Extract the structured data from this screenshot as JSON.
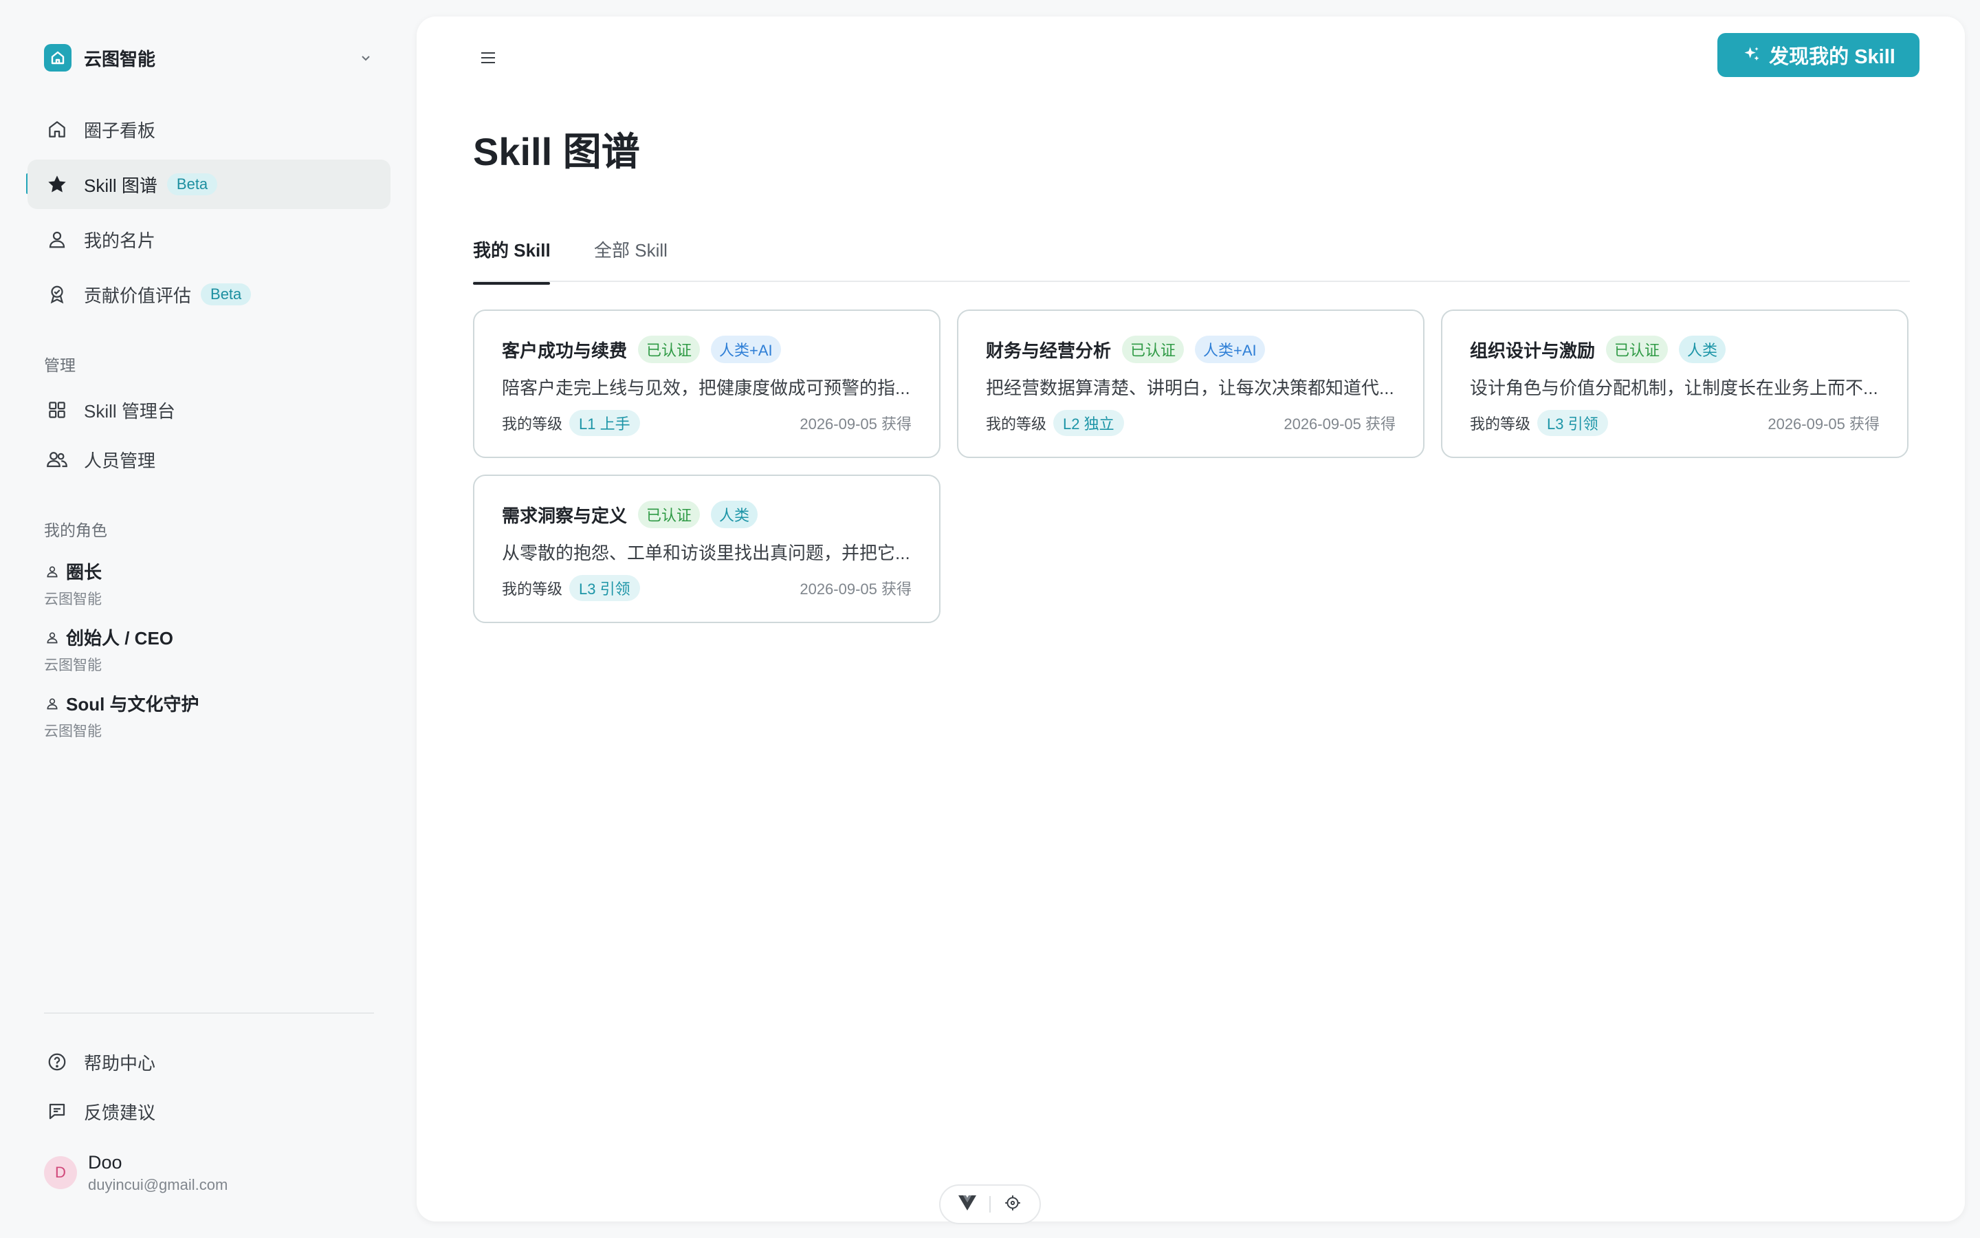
{
  "org": {
    "name": "云图智能"
  },
  "nav": {
    "items": [
      {
        "label": "圈子看板",
        "icon": "home-icon"
      },
      {
        "label": "Skill 图谱",
        "icon": "star-icon",
        "badge": "Beta",
        "active": true
      },
      {
        "label": "我的名片",
        "icon": "user-icon"
      },
      {
        "label": "贡献价值评估",
        "icon": "award-icon",
        "badge": "Beta"
      }
    ],
    "manage_title": "管理",
    "manage_items": [
      {
        "label": "Skill 管理台",
        "icon": "grid-icon"
      },
      {
        "label": "人员管理",
        "icon": "users-icon"
      }
    ],
    "roles_title": "我的角色",
    "roles": [
      {
        "name": "圈长",
        "org": "云图智能"
      },
      {
        "name": "创始人 / CEO",
        "org": "云图智能"
      },
      {
        "name": "Soul 与文化守护",
        "org": "云图智能"
      }
    ],
    "bottom_items": [
      {
        "label": "帮助中心",
        "icon": "help-circle-icon"
      },
      {
        "label": "反馈建议",
        "icon": "feedback-icon"
      }
    ]
  },
  "user": {
    "initial": "D",
    "name": "Doo",
    "email": "duyincui@gmail.com"
  },
  "header": {
    "discover_label": "发现我的 Skill"
  },
  "page": {
    "title": "Skill 图谱",
    "tabs": [
      {
        "label": "我的 Skill",
        "active": true
      },
      {
        "label": "全部 Skill",
        "active": false
      }
    ]
  },
  "cards": [
    {
      "title": "客户成功与续费",
      "cert": "已认证",
      "type": "人类+AI",
      "desc": "陪客户走完上线与见效，把健康度做成可预警的指...",
      "level_label": "我的等级",
      "level": "L1 上手",
      "date": "2026-09-05 获得"
    },
    {
      "title": "财务与经营分析",
      "cert": "已认证",
      "type": "人类+AI",
      "desc": "把经营数据算清楚、讲明白，让每次决策都知道代...",
      "level_label": "我的等级",
      "level": "L2 独立",
      "date": "2026-09-05 获得"
    },
    {
      "title": "组织设计与激励",
      "cert": "已认证",
      "type": "人类",
      "desc": "设计角色与价值分配机制，让制度长在业务上而不...",
      "level_label": "我的等级",
      "level": "L3 引领",
      "date": "2026-09-05 获得"
    },
    {
      "title": "需求洞察与定义",
      "cert": "已认证",
      "type": "人类",
      "desc": "从零散的抱怨、工单和访谈里找出真问题，并把它...",
      "level_label": "我的等级",
      "level": "L3 引领",
      "date": "2026-09-05 获得"
    }
  ],
  "colors": {
    "accent": "#22a5b8",
    "cert_green": "#2f9a45",
    "ai_blue": "#2f7fd6"
  }
}
